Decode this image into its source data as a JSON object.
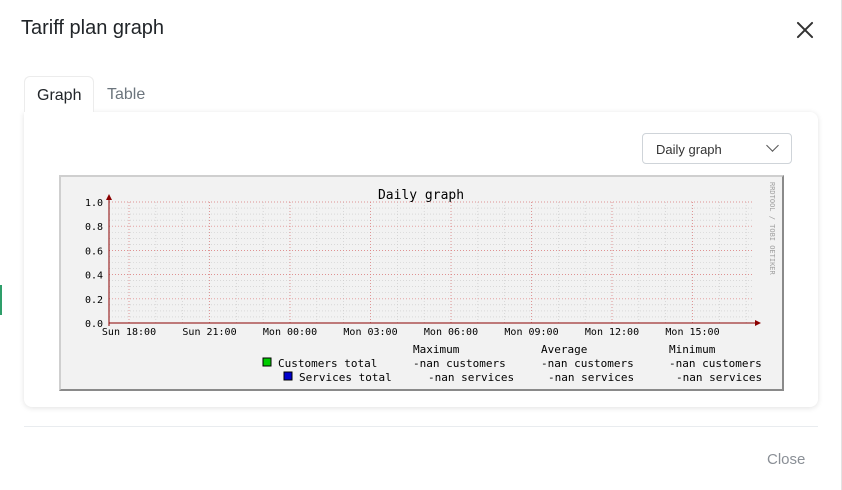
{
  "modal": {
    "title": "Tariff plan graph",
    "close_button_label": "Close"
  },
  "tabs": [
    {
      "label": "Graph",
      "active": true
    },
    {
      "label": "Table",
      "active": false
    }
  ],
  "period_select": {
    "value": "Daily graph"
  },
  "chart_data": {
    "type": "line",
    "title": "Daily graph",
    "watermark": "RRDTOOL / TOBI OETIKER",
    "y_ticks": [
      "1.0",
      "0.8",
      "0.6",
      "0.4",
      "0.2",
      "0.0"
    ],
    "ylim": [
      0,
      1
    ],
    "x_ticks": [
      "Sun 18:00",
      "Sun 21:00",
      "Mon 00:00",
      "Mon 03:00",
      "Mon 06:00",
      "Mon 09:00",
      "Mon 12:00",
      "Mon 15:00"
    ],
    "grid": true,
    "legend_headers": [
      "Maximum",
      "Average",
      "Minimum"
    ],
    "series": [
      {
        "name": "Customers total",
        "color": "#00cc00",
        "maximum": "-nan customers",
        "average": "-nan customers",
        "minimum": "-nan customers",
        "values": []
      },
      {
        "name": "Services total",
        "color": "#0000cc",
        "maximum": "-nan services",
        "average": "-nan services",
        "minimum": "-nan services",
        "values": []
      }
    ]
  },
  "colors": {
    "grid_minor": "#c8c8c8",
    "grid_major": "#e07a7a",
    "axis": "#8b0000",
    "accent": "#2e9e6a"
  }
}
